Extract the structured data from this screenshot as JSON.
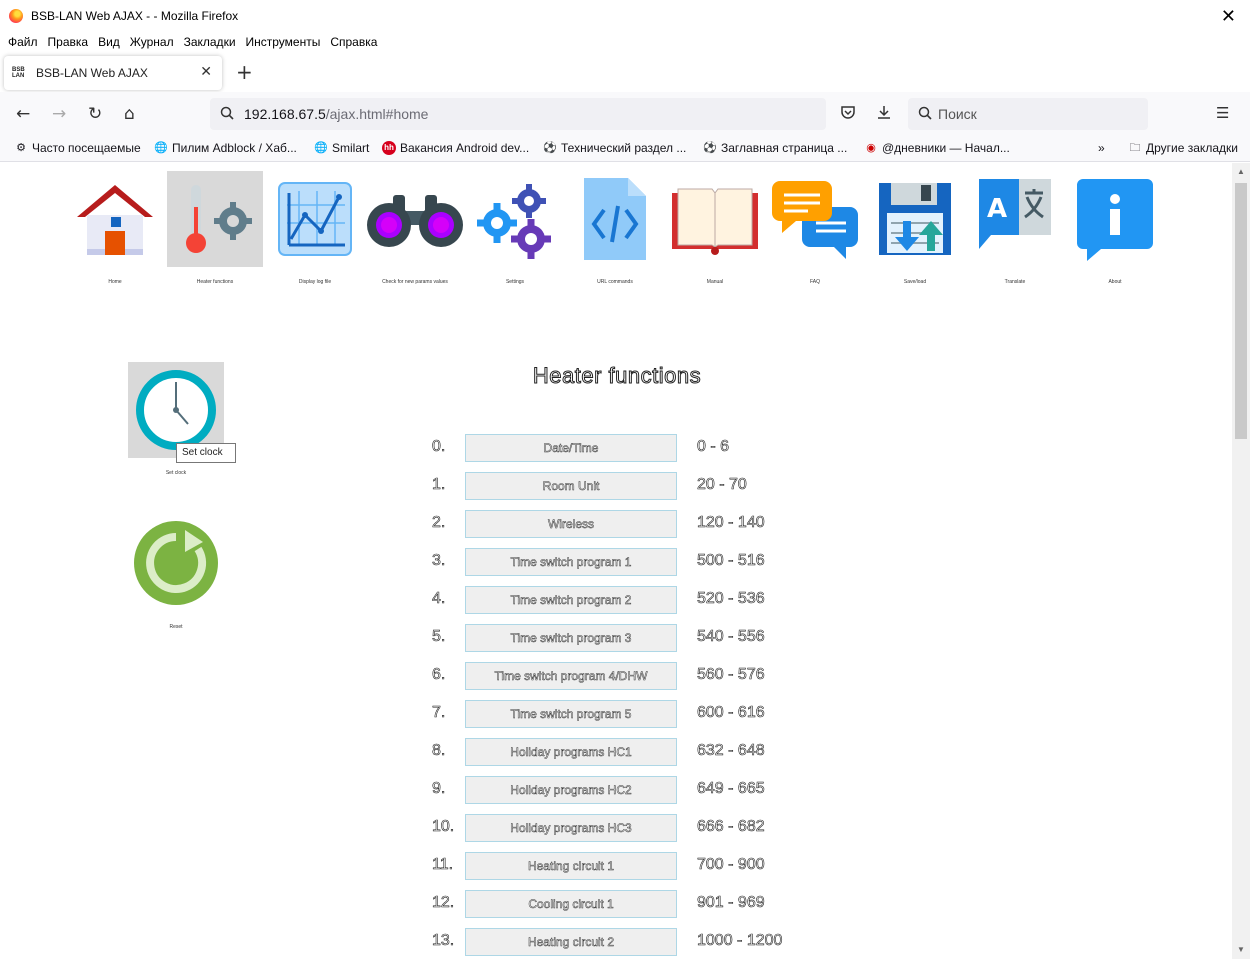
{
  "window": {
    "title": "BSB-LAN Web AJAX - - Mozilla Firefox"
  },
  "menu": [
    "Файл",
    "Правка",
    "Вид",
    "Журнал",
    "Закладки",
    "Инструменты",
    "Справка"
  ],
  "tab": {
    "favicon_text": "BSB LAN",
    "title": "BSB-LAN Web AJAX"
  },
  "nav": {
    "url_host": "192.168.67.5",
    "url_path": "/ajax.html#home",
    "search_placeholder": "Поиск"
  },
  "bookmarks": [
    {
      "label": "Часто посещаемые",
      "icon": "gear-icon"
    },
    {
      "label": "Пилим Adblock / Хаб...",
      "icon": "globe-icon"
    },
    {
      "label": "Smilart",
      "icon": "globe-icon"
    },
    {
      "label": "Вакансия Android dev...",
      "icon": "hh-icon"
    },
    {
      "label": "Технический раздел ...",
      "icon": "soccer-icon"
    },
    {
      "label": "Заглавная страница ...",
      "icon": "soccer-icon"
    },
    {
      "label": "@дневники — Начал...",
      "icon": "diary-icon"
    }
  ],
  "other_bookmarks": "Другие закладки",
  "top_icons": [
    {
      "label": "Home",
      "icon": "house-icon"
    },
    {
      "label": "Heater functions",
      "icon": "thermometer-gear-icon"
    },
    {
      "label": "Display log file",
      "icon": "chart-icon"
    },
    {
      "label": "Check for new params values",
      "icon": "binoculars-icon"
    },
    {
      "label": "Settings",
      "icon": "gears-icon"
    },
    {
      "label": "URL commands",
      "icon": "code-file-icon"
    },
    {
      "label": "Manual",
      "icon": "book-icon"
    },
    {
      "label": "FAQ",
      "icon": "chat-icon"
    },
    {
      "label": "Save/load",
      "icon": "floppy-icon"
    },
    {
      "label": "Translate",
      "icon": "translate-icon"
    },
    {
      "label": "About",
      "icon": "info-icon"
    }
  ],
  "side": {
    "set_clock_label": "Set clock",
    "tooltip": "Set clock",
    "reset_label": "Reset"
  },
  "heading": "Heater functions",
  "functions": [
    {
      "num": "0.",
      "label": "Date/Time",
      "range": "0 - 6"
    },
    {
      "num": "1.",
      "label": "Room Unit",
      "range": "20 - 70"
    },
    {
      "num": "2.",
      "label": "Wireless",
      "range": "120 - 140"
    },
    {
      "num": "3.",
      "label": "Time switch program 1",
      "range": "500 - 516"
    },
    {
      "num": "4.",
      "label": "Time switch program 2",
      "range": "520 - 536"
    },
    {
      "num": "5.",
      "label": "Time switch program 3",
      "range": "540 - 556"
    },
    {
      "num": "6.",
      "label": "Time switch program 4/DHW",
      "range": "560 - 576"
    },
    {
      "num": "7.",
      "label": "Time switch program 5",
      "range": "600 - 616"
    },
    {
      "num": "8.",
      "label": "Holiday programs HC1",
      "range": "632 - 648"
    },
    {
      "num": "9.",
      "label": "Holiday programs HC2",
      "range": "649 - 665"
    },
    {
      "num": "10.",
      "label": "Holiday programs HC3",
      "range": "666 - 682"
    },
    {
      "num": "11.",
      "label": "Heating circuit 1",
      "range": "700 - 900"
    },
    {
      "num": "12.",
      "label": "Cooling circuit 1",
      "range": "901 - 969"
    },
    {
      "num": "13.",
      "label": "Heating circuit 2",
      "range": "1000 - 1200"
    }
  ]
}
